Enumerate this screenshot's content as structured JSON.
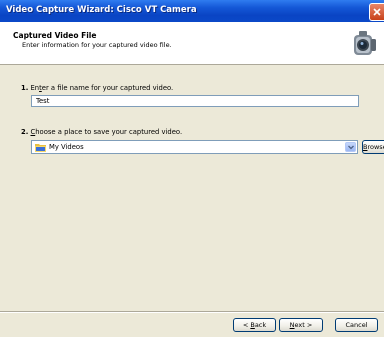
{
  "window": {
    "title": "Video Capture Wizard: Cisco VT Camera"
  },
  "header": {
    "title": "Captured Video File",
    "subtitle": "Enter information for your captured video file."
  },
  "step1": {
    "number": "1.",
    "label_pre": "En",
    "label_key": "t",
    "label_post": "er a file name for your captured video.",
    "value": "Test"
  },
  "step2": {
    "number": "2.",
    "label_key": "C",
    "label_post": "hoose a place to save your captured video.",
    "folder": "My Videos",
    "browse_key": "B",
    "browse_post": "rowse..."
  },
  "buttons": {
    "back_pre": "< ",
    "back_key": "B",
    "back_post": "ack",
    "next_key": "N",
    "next_post": "ext >",
    "cancel": "Cancel"
  }
}
